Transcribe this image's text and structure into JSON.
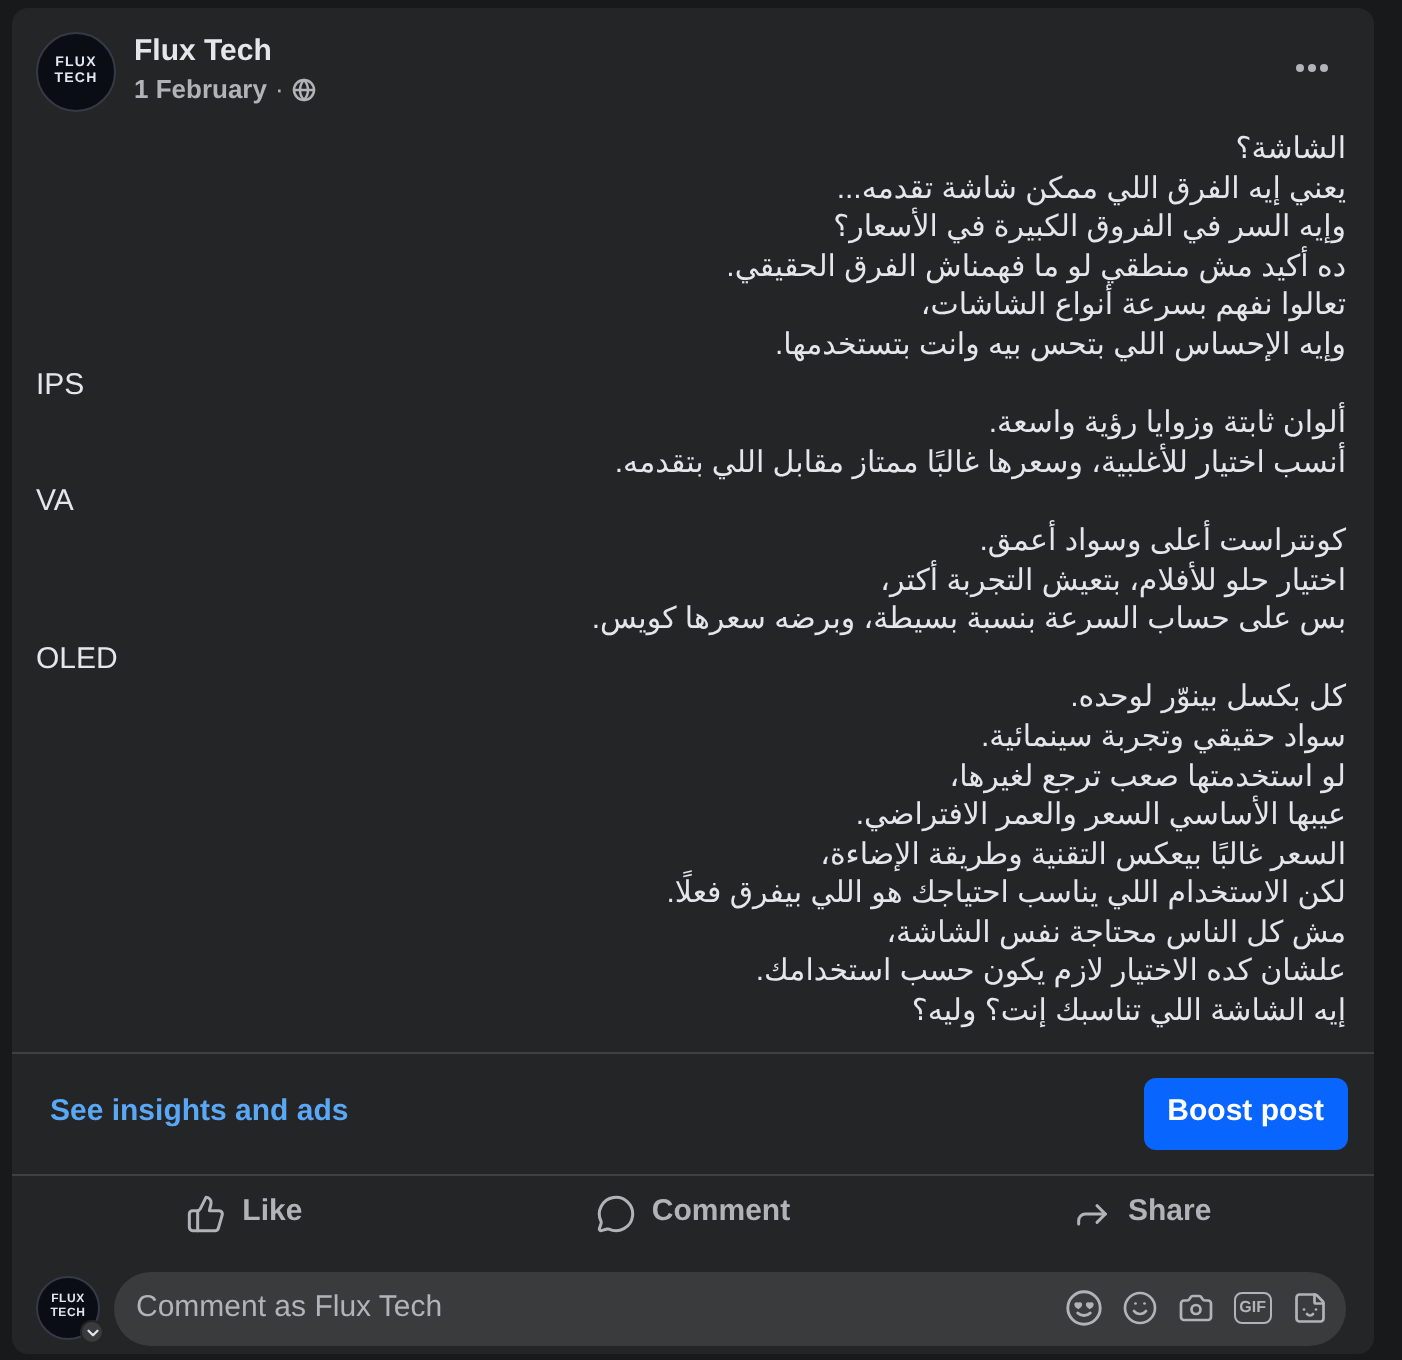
{
  "post": {
    "author": "Flux Tech",
    "avatar_text": [
      "FLUX",
      "TECH"
    ],
    "date": "1 February",
    "separator": "·",
    "body_lines": [
      "الشاشة؟",
      "يعني إيه الفرق اللي ممكن شاشة تقدمه...",
      "وإيه السر في الفروق الكبيرة في الأسعار؟",
      "ده أكيد مش منطقي لو ما فهمناش الفرق الحقيقي.",
      "تعالوا نفهم بسرعة أنواع الشاشات،",
      "وإيه الإحساس اللي بتحس بيه وانت بتستخدمها.",
      "IPS",
      "ألوان ثابتة وزوايا رؤية واسعة.",
      "أنسب اختيار للأغلبية، وسعرها غالبًا ممتاز مقابل اللي بتقدمه.",
      "VA",
      "كونتراست أعلى وسواد أعمق.",
      "اختيار حلو للأفلام، بتعيش التجربة أكتر،",
      "بس على حساب السرعة بنسبة بسيطة، وبرضه سعرها كويس.",
      "OLED",
      "كل بكسل بينوّر لوحده.",
      "سواد حقيقي وتجربة سينمائية.",
      "لو استخدمتها صعب ترجع لغيرها،",
      "عيبها الأساسي السعر والعمر الافتراضي.",
      "السعر غالبًا بيعكس التقنية وطريقة الإضاءة،",
      "لكن الاستخدام اللي يناسب احتياجك هو اللي بيفرق فعلًا.",
      "مش كل الناس محتاجة نفس الشاشة،",
      "علشان كده الاختيار لازم يكون حسب استخدامك.",
      "إيه الشاشة اللي تناسبك إنت؟ وليه؟"
    ]
  },
  "insights": {
    "link": "See insights and ads",
    "button": "Boost post"
  },
  "actions": {
    "like": "Like",
    "comment": "Comment",
    "share": "Share"
  },
  "comment_box": {
    "avatar_text": [
      "FLUX",
      "TECH"
    ],
    "placeholder": "Comment as Flux Tech",
    "tools": [
      {
        "kind": "avatar"
      },
      {
        "kind": "emoji"
      },
      {
        "kind": "camera"
      },
      {
        "kind": "gif",
        "label": "GIF"
      },
      {
        "kind": "sticker"
      }
    ]
  }
}
